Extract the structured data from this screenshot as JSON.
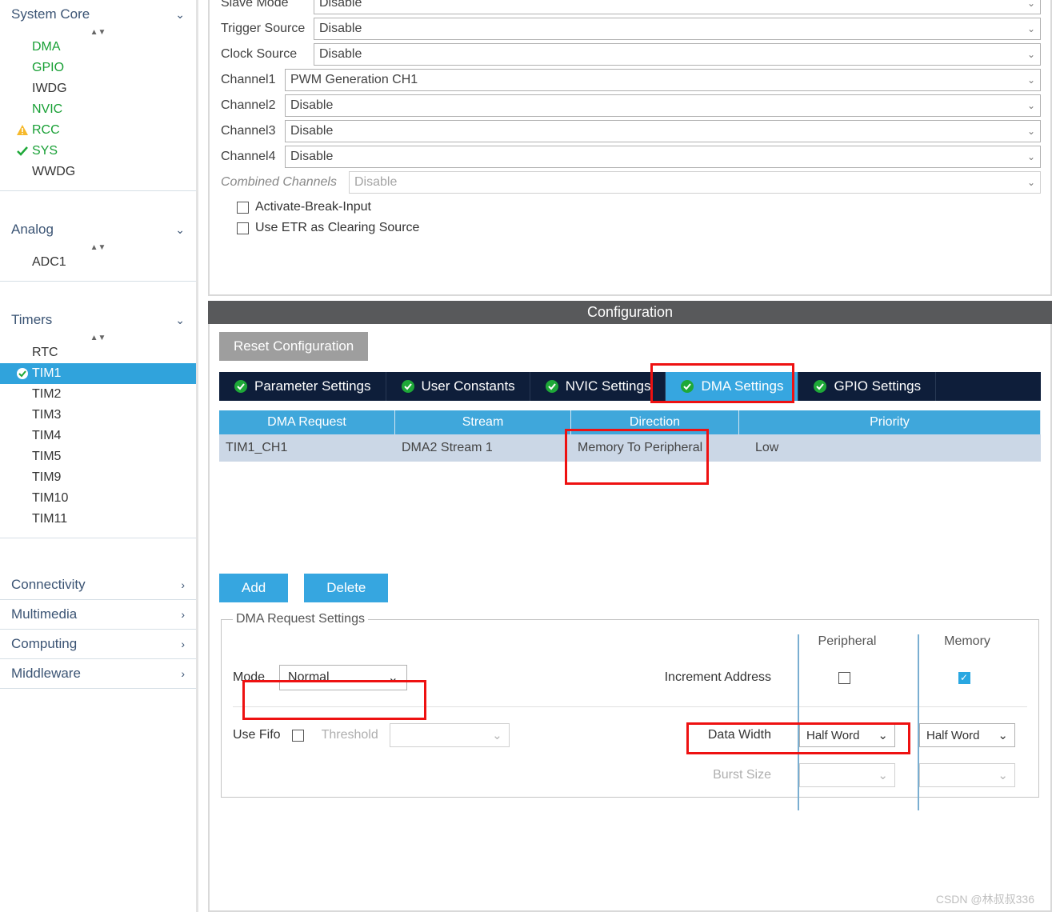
{
  "sidebar": {
    "categories": [
      {
        "name": "System Core",
        "expanded": true,
        "items": [
          {
            "label": "DMA",
            "style": "green"
          },
          {
            "label": "GPIO",
            "style": "green"
          },
          {
            "label": "IWDG",
            "style": ""
          },
          {
            "label": "NVIC",
            "style": "green"
          },
          {
            "label": "RCC",
            "style": "green",
            "badge": "warn"
          },
          {
            "label": "SYS",
            "style": "green",
            "badge": "ok"
          },
          {
            "label": "WWDG",
            "style": ""
          }
        ]
      },
      {
        "name": "Analog",
        "expanded": true,
        "items": [
          {
            "label": "ADC1",
            "style": ""
          }
        ]
      },
      {
        "name": "Timers",
        "expanded": true,
        "items": [
          {
            "label": "RTC",
            "style": ""
          },
          {
            "label": "TIM1",
            "style": "",
            "selected": true,
            "badge": "ok"
          },
          {
            "label": "TIM2",
            "style": ""
          },
          {
            "label": "TIM3",
            "style": ""
          },
          {
            "label": "TIM4",
            "style": ""
          },
          {
            "label": "TIM5",
            "style": ""
          },
          {
            "label": "TIM9",
            "style": ""
          },
          {
            "label": "TIM10",
            "style": ""
          },
          {
            "label": "TIM11",
            "style": ""
          }
        ]
      },
      {
        "name": "Connectivity",
        "expanded": false
      },
      {
        "name": "Multimedia",
        "expanded": false
      },
      {
        "name": "Computing",
        "expanded": false
      },
      {
        "name": "Middleware",
        "expanded": false
      }
    ]
  },
  "mode": {
    "rows": [
      {
        "label": "Slave Mode",
        "value": "Disable"
      },
      {
        "label": "Trigger Source",
        "value": "Disable"
      },
      {
        "label": "Clock Source",
        "value": "Disable"
      },
      {
        "label": "Channel1",
        "value": "PWM Generation CH1"
      },
      {
        "label": "Channel2",
        "value": "Disable"
      },
      {
        "label": "Channel3",
        "value": "Disable"
      },
      {
        "label": "Channel4",
        "value": "Disable"
      },
      {
        "label": "Combined Channels",
        "value": "Disable",
        "disabled": true
      }
    ],
    "check1": "Activate-Break-Input",
    "check2": "Use ETR as Clearing Source"
  },
  "config": {
    "header": "Configuration",
    "reset": "Reset Configuration",
    "tabs": [
      {
        "label": "Parameter Settings"
      },
      {
        "label": "User Constants"
      },
      {
        "label": "NVIC Settings"
      },
      {
        "label": "DMA Settings",
        "active": true
      },
      {
        "label": "GPIO Settings"
      }
    ],
    "table": {
      "headers": [
        "DMA Request",
        "Stream",
        "Direction",
        "Priority"
      ],
      "row": [
        "TIM1_CH1",
        "DMA2 Stream 1",
        "Memory To Peripheral",
        "Low"
      ]
    },
    "add": "Add",
    "delete": "Delete",
    "dma_settings_legend": "DMA Request Settings",
    "col_periph": "Peripheral",
    "col_mem": "Memory",
    "mode_label": "Mode",
    "mode_value": "Normal",
    "inc_addr": "Increment Address",
    "fifo_label": "Use Fifo",
    "threshold_label": "Threshold",
    "datawidth_label": "Data Width",
    "datawidth_p": "Half Word",
    "datawidth_m": "Half Word",
    "burst_label": "Burst Size"
  },
  "watermark": "CSDN @林叔叔336"
}
